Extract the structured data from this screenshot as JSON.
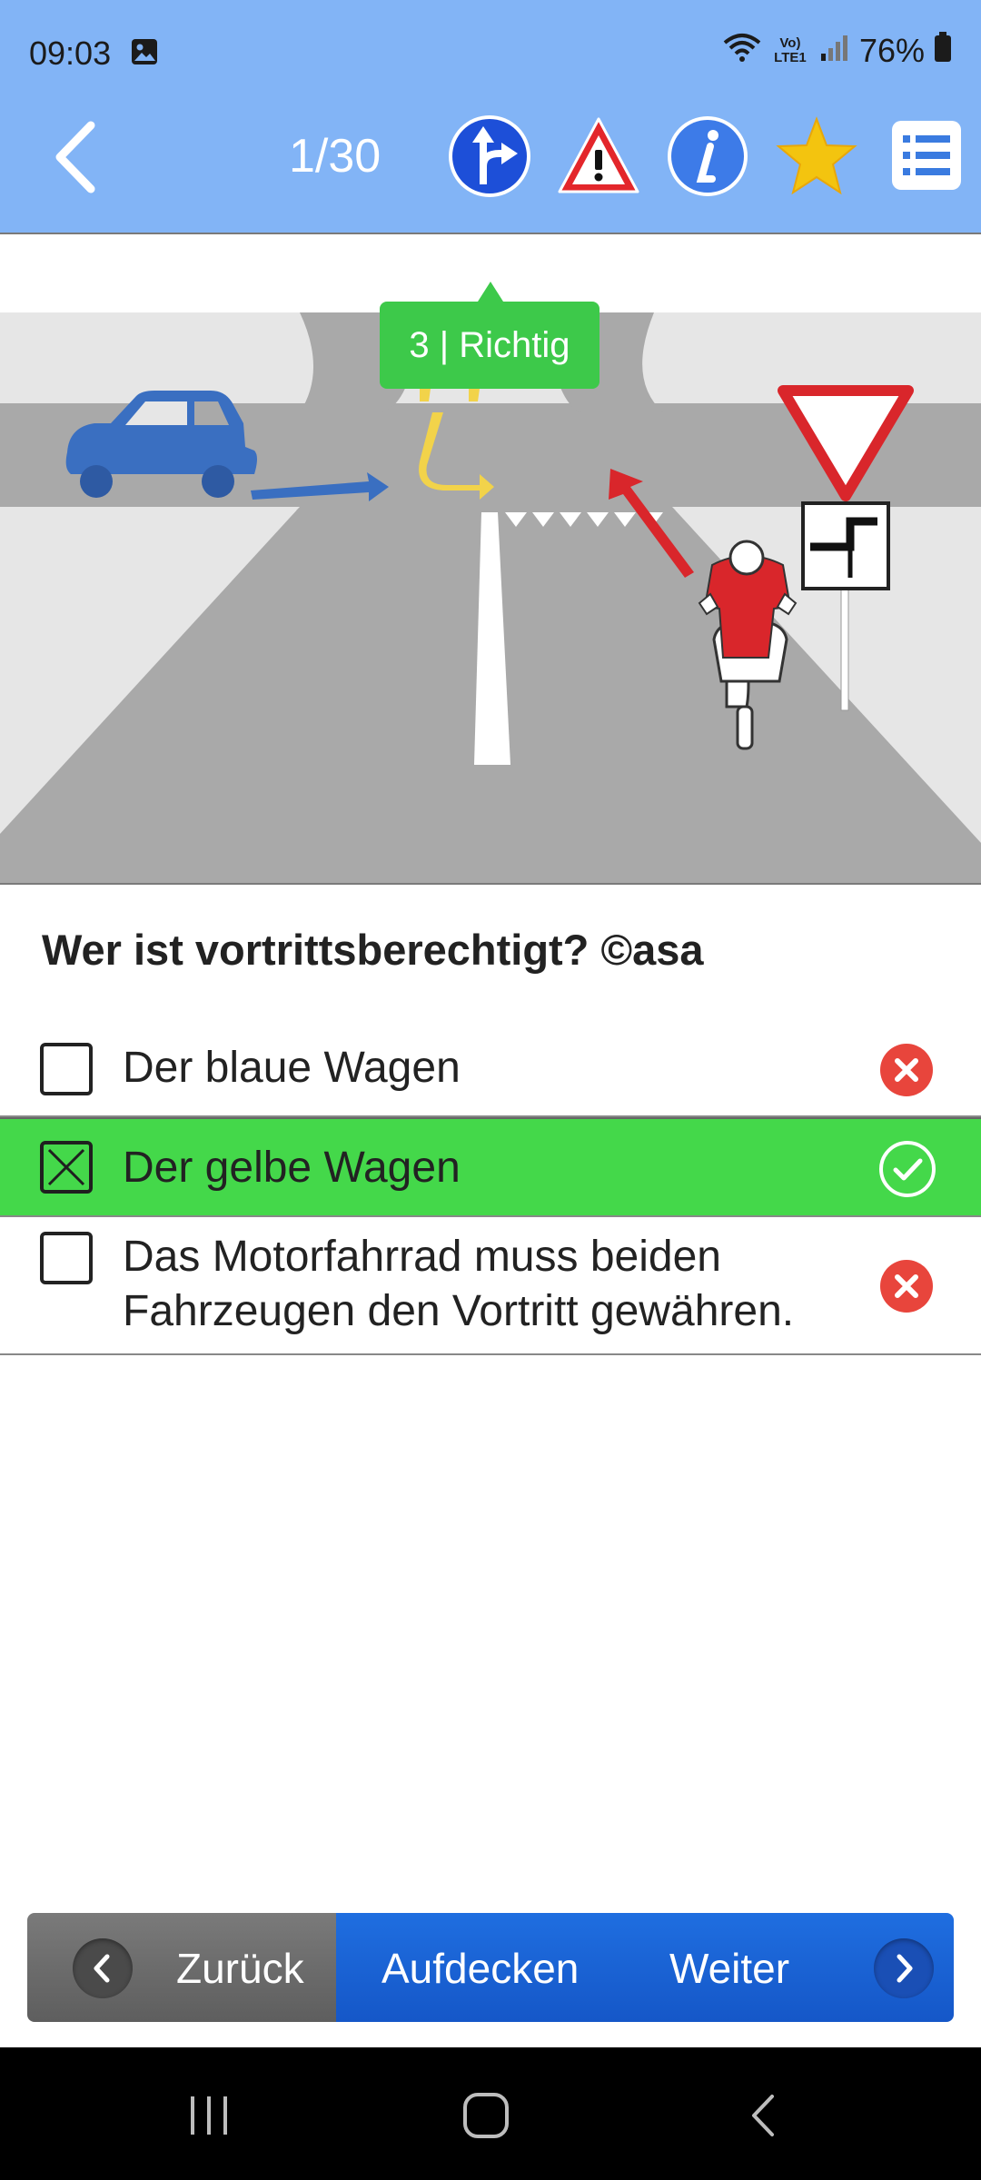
{
  "status_bar": {
    "time": "09:03",
    "network": "Vo) LTE1",
    "battery": "76%",
    "icons": [
      "gallery-icon",
      "wifi-icon",
      "volte-icon",
      "signal-icon",
      "battery-icon"
    ]
  },
  "app_bar": {
    "counter": "1/30",
    "icons": [
      "back-icon",
      "right-of-way-sign-icon",
      "warning-sign-icon",
      "info-icon",
      "star-icon",
      "list-icon"
    ]
  },
  "illustration": {
    "badge": "3 | Richtig"
  },
  "question": {
    "text": "Wer ist vortrittsberechtigt? ©asa",
    "answers": [
      {
        "line1": "Der blaue Wagen",
        "line2": "",
        "checked": false,
        "result": "wrong"
      },
      {
        "line1": "Der gelbe Wagen",
        "line2": "",
        "checked": true,
        "result": "correct"
      },
      {
        "line1": "Das Motorfahrrad muss beiden",
        "line2": "Fahrzeugen den Vortritt gewähren.",
        "checked": false,
        "result": "wrong"
      }
    ]
  },
  "nav": {
    "back_label": "Zurück",
    "reveal_label": "Aufdecken",
    "next_label": "Weiter"
  },
  "colors": {
    "app_bar": "#82b4f6",
    "correct_row": "#44d84a",
    "wrong_icon": "#e8453c",
    "nav_blue": "#1f6ee0",
    "nav_grey": "#6b6b6b"
  }
}
